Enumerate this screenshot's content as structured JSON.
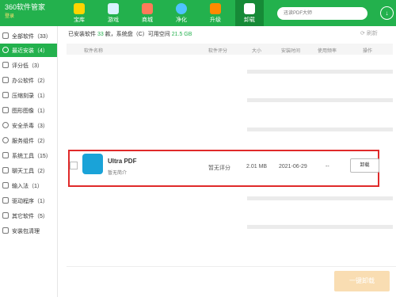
{
  "app": {
    "title": "360软件管家",
    "login": "登录"
  },
  "nav": [
    {
      "label": "宝库",
      "icon": "star-icon",
      "color": "#ffd400",
      "active": false
    },
    {
      "label": "游戏",
      "icon": "gamepad-icon",
      "color": "#d9f2ff",
      "active": false
    },
    {
      "label": "商城",
      "icon": "shopping-bag-icon",
      "color": "#ff7a59",
      "active": false
    },
    {
      "label": "净化",
      "icon": "purify-icon",
      "color": "#4fc3ff",
      "active": false
    },
    {
      "label": "升级",
      "icon": "upgrade-icon",
      "color": "#ff8a00",
      "active": false
    },
    {
      "label": "卸载",
      "icon": "trash-icon",
      "color": "#ffffff",
      "active": true
    }
  ],
  "search": {
    "placeholder": "迅读PDF大师"
  },
  "sidebar": [
    {
      "label": "全部软件（33）",
      "icon": "all-apps-icon",
      "active": false
    },
    {
      "label": "最近安装（4）",
      "icon": "clock-icon",
      "active": true
    },
    {
      "label": "评分低（3）",
      "icon": "low-rating-icon",
      "active": false
    },
    {
      "label": "办公软件（2）",
      "icon": "office-icon",
      "active": false
    },
    {
      "label": "压缩刻录（1）",
      "icon": "compress-icon",
      "active": false
    },
    {
      "label": "图形图像（1）",
      "icon": "image-icon",
      "active": false
    },
    {
      "label": "安全杀毒（3）",
      "icon": "security-icon",
      "active": false
    },
    {
      "label": "服务组件（2）",
      "icon": "service-icon",
      "active": false
    },
    {
      "label": "系统工具（15）",
      "icon": "system-tools-icon",
      "active": false
    },
    {
      "label": "聊天工具（2）",
      "icon": "chat-icon",
      "active": false
    },
    {
      "label": "输入法（1）",
      "icon": "keyboard-icon",
      "active": false
    },
    {
      "label": "驱动程序（1）",
      "icon": "driver-icon",
      "active": false
    },
    {
      "label": "其它软件（5）",
      "icon": "other-icon",
      "active": false
    },
    {
      "label": "安装包清理",
      "icon": "cleanup-icon",
      "active": false
    }
  ],
  "info": {
    "prefix": "已安装软件",
    "count": "33",
    "mid": "款，系统盘（C）可用空间",
    "space": "21.5 GB"
  },
  "refresh_label": "刷新",
  "table_headers": [
    "软件名称",
    "软件评分",
    "大小",
    "安装时间",
    "使用频率",
    "操作"
  ],
  "app_row": {
    "name": "Ultra PDF",
    "desc": "暂无简介",
    "rating": "暂无评分",
    "size": "2.01 MB",
    "date": "2021-06-29",
    "freq": "--",
    "action": "卸载"
  },
  "bulk_uninstall": "一键卸载",
  "colors": {
    "brand": "#23b14d",
    "highlight": "#e02a2a"
  }
}
